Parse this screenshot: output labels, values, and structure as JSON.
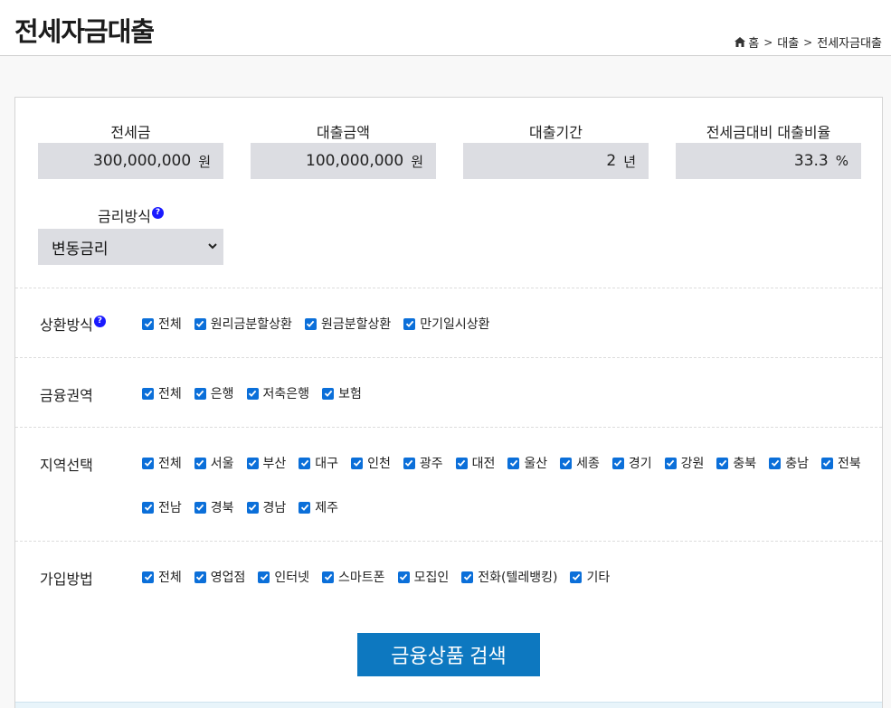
{
  "header": {
    "title": "전세자금대출",
    "breadcrumb": [
      "홈",
      "대출",
      "전세자금대출"
    ]
  },
  "fields": {
    "deposit": {
      "label": "전세금",
      "value": "300,000,000",
      "unit": "원"
    },
    "loan_amount": {
      "label": "대출금액",
      "value": "100,000,000",
      "unit": "원"
    },
    "loan_period": {
      "label": "대출기간",
      "value": "2",
      "unit": "년"
    },
    "loan_ratio": {
      "label": "전세금대비 대출비율",
      "value": "33.3",
      "unit": "%"
    }
  },
  "rate_type": {
    "label": "금리방식",
    "help": "?",
    "selected": "변동금리"
  },
  "repayment": {
    "label": "상환방식",
    "help": "?",
    "options": [
      "전체",
      "원리금분할상환",
      "원금분할상환",
      "만기일시상환"
    ]
  },
  "financial_sector": {
    "label": "금융권역",
    "options": [
      "전체",
      "은행",
      "저축은행",
      "보험"
    ]
  },
  "region": {
    "label": "지역선택",
    "options_row1": [
      "전체",
      "서울",
      "부산",
      "대구",
      "인천",
      "광주",
      "대전",
      "울산",
      "세종",
      "경기",
      "강원",
      "충북",
      "충남",
      "전북"
    ],
    "options_row2": [
      "전남",
      "경북",
      "경남",
      "제주"
    ]
  },
  "join_method": {
    "label": "가입방법",
    "options": [
      "전체",
      "영업점",
      "인터넷",
      "스마트폰",
      "모집인",
      "전화(텔레뱅킹)",
      "기타"
    ]
  },
  "search_button": {
    "label": "금융상품 검색"
  },
  "colors": {
    "accent": "#0d78c0",
    "checkbox": "#0b6fd9",
    "input_bg": "#dcdde2",
    "help": "#1a1aff"
  }
}
